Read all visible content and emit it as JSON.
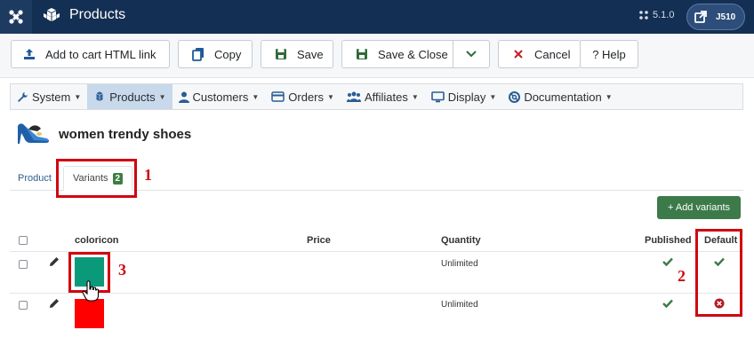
{
  "topbar": {
    "title": "Products",
    "version": "5.1.0",
    "user": "J510"
  },
  "toolbar": {
    "add_cart_link": "Add to cart HTML link",
    "copy": "Copy",
    "save": "Save",
    "save_close": "Save & Close",
    "cancel": "Cancel",
    "help": "? Help"
  },
  "menu": {
    "items": [
      {
        "label": "System",
        "icon": "wrench-icon"
      },
      {
        "label": "Products",
        "icon": "cubes-icon"
      },
      {
        "label": "Customers",
        "icon": "user-icon"
      },
      {
        "label": "Orders",
        "icon": "credit-card-icon"
      },
      {
        "label": "Affiliates",
        "icon": "users-icon"
      },
      {
        "label": "Display",
        "icon": "monitor-icon"
      },
      {
        "label": "Documentation",
        "icon": "lifebuoy-icon"
      }
    ],
    "active": "Products"
  },
  "product": {
    "title": "women trendy shoes"
  },
  "tabs": {
    "product": "Product",
    "variants": "Variants",
    "variants_count": "2"
  },
  "variants": {
    "add_button": "+ Add variants",
    "columns": {
      "coloricon": "coloricon",
      "price": "Price",
      "quantity": "Quantity",
      "published": "Published",
      "default": "Default"
    },
    "rows": [
      {
        "color": "#0a9a7a",
        "price": "",
        "quantity": "Unlimited",
        "published": true,
        "default": true
      },
      {
        "color": "#ff0000",
        "price": "",
        "quantity": "Unlimited",
        "published": true,
        "default": false
      }
    ]
  },
  "annotations": {
    "one": "1",
    "two": "2",
    "three": "3"
  },
  "colors": {
    "topbar": "#132f53",
    "annotation": "#d0060f",
    "success": "#3c7a4a",
    "menu_active": "#c7d9ea"
  }
}
